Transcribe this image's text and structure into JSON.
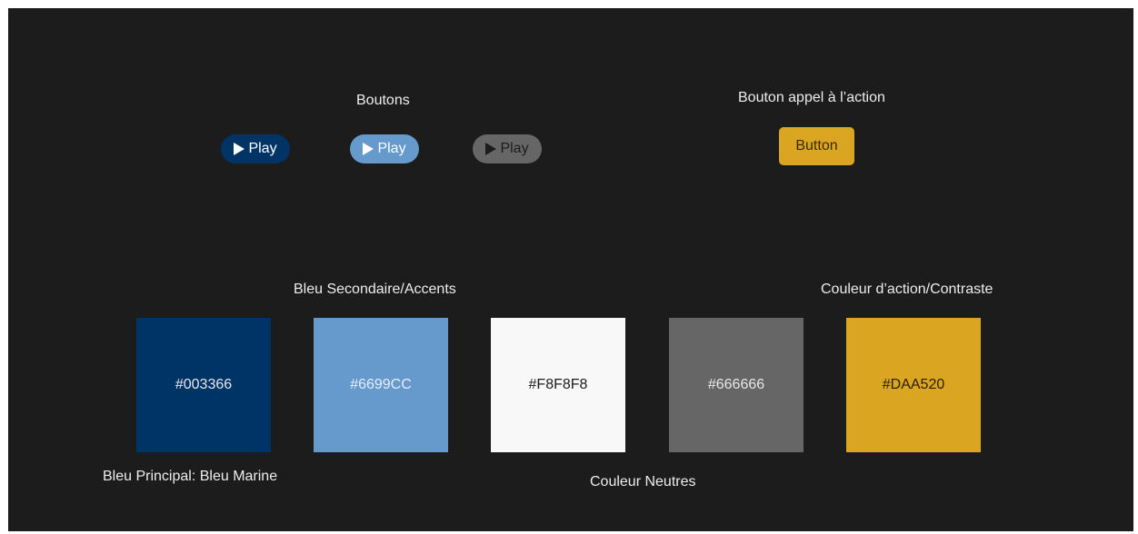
{
  "buttons_section": {
    "title": "Boutons",
    "play_buttons": [
      {
        "label": "Play",
        "bg": "#003366",
        "fg": "#FFFFFF"
      },
      {
        "label": "Play",
        "bg": "#6699CC",
        "fg": "#FFFFFF"
      },
      {
        "label": "Play",
        "bg": "#666666",
        "fg": "#1C1C1C"
      }
    ],
    "play_icon": "play-triangle-icon"
  },
  "cta_section": {
    "title": "Bouton appel à l’action",
    "button_label": "Button",
    "button_color": "#DAA520"
  },
  "palette": {
    "labels": {
      "primary": "Bleu Principal: Bleu Marine",
      "secondary": "Bleu Secondaire/Accents",
      "neutrals": "Couleur Neutres",
      "action": "Couleur d’action/Contraste"
    },
    "swatches": [
      {
        "hex": "#003366",
        "text_color": "#E8E8E8"
      },
      {
        "hex": "#6699CC",
        "text_color": "#E8EEF6"
      },
      {
        "hex": "#F8F8F8",
        "text_color": "#1C1C1C"
      },
      {
        "hex": "#666666",
        "text_color": "#E8E8E8"
      },
      {
        "hex": "#DAA520",
        "text_color": "#2A1E05"
      }
    ]
  },
  "colors": {
    "background": "#1C1C1C",
    "text": "#EDEDED"
  }
}
